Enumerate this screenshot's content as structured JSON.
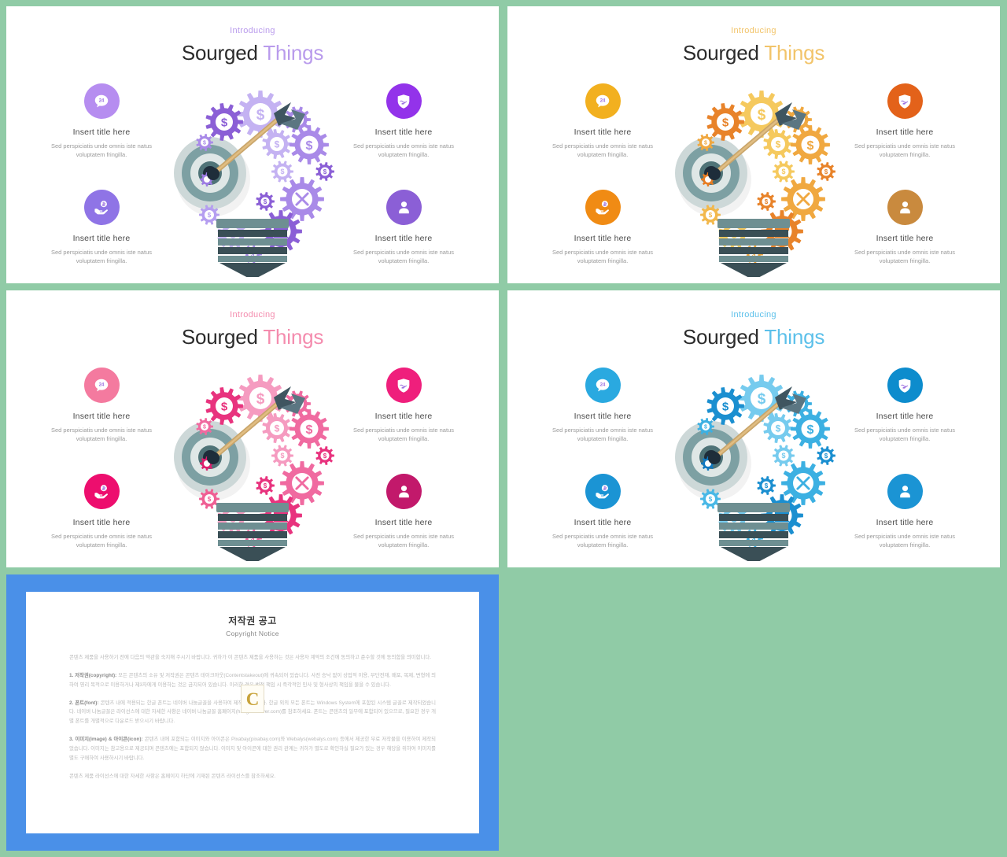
{
  "background_color": "#90cba6",
  "slides": [
    {
      "id": "purple",
      "accent": "#9b6fe0",
      "accent_light": "#b99bec",
      "intro": "Introducing",
      "title_word1": "Sourged",
      "title_word2": "Things",
      "gear_colors": [
        "#8b5fd6",
        "#a98ae8",
        "#c4b2f2",
        "#9d7ce4",
        "#b59ef0",
        "#7f4fd0",
        "#cbbdf5"
      ],
      "items": [
        {
          "icon": "chat-bubble-icon",
          "title": "Insert title here",
          "desc": "Sed perspiciatis unde omnis iste natus voluptatem fringilla."
        },
        {
          "icon": "hand-money-icon",
          "title": "Insert title here",
          "desc": "Sed perspiciatis unde omnis iste natus voluptatem fringilla."
        },
        {
          "icon": "shield-hand-icon",
          "title": "Insert title here",
          "desc": "Sed perspiciatis unde omnis iste natus voluptatem fringilla."
        },
        {
          "icon": "user-icon",
          "title": "Insert title here",
          "desc": "Sed perspiciatis unde omnis iste natus voluptatem fringilla."
        }
      ],
      "item_icon_colors": [
        "#b68df0",
        "#8f74e6",
        "#9333ea",
        "#8b5fd6"
      ]
    },
    {
      "id": "orange",
      "accent": "#e8a33a",
      "accent_light": "#f2c46a",
      "intro": "Introducing",
      "title_word1": "Sourged",
      "title_word2": "Things",
      "gear_colors": [
        "#e8832a",
        "#f0a840",
        "#f5c95e",
        "#e87d22",
        "#f2b84c",
        "#d96a18",
        "#f7d77e"
      ],
      "items": [
        {
          "icon": "chat-bubble-icon",
          "title": "Insert title here",
          "desc": "Sed perspiciatis unde omnis iste natus voluptatem fringilla."
        },
        {
          "icon": "hand-money-icon",
          "title": "Insert title here",
          "desc": "Sed perspiciatis unde omnis iste natus voluptatem fringilla."
        },
        {
          "icon": "shield-hand-icon",
          "title": "Insert title here",
          "desc": "Sed perspiciatis unde omnis iste natus voluptatem fringilla."
        },
        {
          "icon": "user-icon",
          "title": "Insert title here",
          "desc": "Sed perspiciatis unde omnis iste natus voluptatem fringilla."
        }
      ],
      "item_icon_colors": [
        "#f2b01f",
        "#f08b14",
        "#e3621a",
        "#c98a3e"
      ]
    },
    {
      "id": "pink",
      "accent": "#ef5f8c",
      "accent_light": "#f48cae",
      "intro": "Introducing",
      "title_word1": "Sourged",
      "title_word2": "Things",
      "gear_colors": [
        "#e8337e",
        "#f06aa0",
        "#f59bc0",
        "#de1f6e",
        "#ef5f94",
        "#c71563",
        "#f7b6d2"
      ],
      "items": [
        {
          "icon": "chat-bubble-icon",
          "title": "Insert title here",
          "desc": "Sed perspiciatis unde omnis iste natus voluptatem fringilla."
        },
        {
          "icon": "hand-money-icon",
          "title": "Insert title here",
          "desc": "Sed perspiciatis unde omnis iste natus voluptatem fringilla."
        },
        {
          "icon": "shield-hand-icon",
          "title": "Insert title here",
          "desc": "Sed perspiciatis unde omnis iste natus voluptatem fringilla."
        },
        {
          "icon": "user-icon",
          "title": "Insert title here",
          "desc": "Sed perspiciatis unde omnis iste natus voluptatem fringilla."
        }
      ],
      "item_icon_colors": [
        "#f47a9f",
        "#ed0e6e",
        "#ef1f7c",
        "#c2196b"
      ]
    },
    {
      "id": "blue",
      "accent": "#29a3dc",
      "accent_light": "#5cc0ea",
      "intro": "Introducing",
      "title_word1": "Sourged",
      "title_word2": "Things",
      "gear_colors": [
        "#1b8fd0",
        "#3cb0e2",
        "#76cbee",
        "#1078c0",
        "#49b8e6",
        "#0a68ae",
        "#9adcf3"
      ],
      "items": [
        {
          "icon": "chat-bubble-icon",
          "title": "Insert title here",
          "desc": "Sed perspiciatis unde omnis iste natus voluptatem fringilla."
        },
        {
          "icon": "hand-money-icon",
          "title": "Insert title here",
          "desc": "Sed perspiciatis unde omnis iste natus voluptatem fringilla."
        },
        {
          "icon": "shield-hand-icon",
          "title": "Insert title here",
          "desc": "Sed perspiciatis unde omnis iste natus voluptatem fringilla."
        },
        {
          "icon": "user-icon",
          "title": "Insert title here",
          "desc": "Sed perspiciatis unde omnis iste natus voluptatem fringilla."
        }
      ],
      "item_icon_colors": [
        "#2aa9e0",
        "#1b94d4",
        "#0d8ccd",
        "#1b94d4"
      ]
    }
  ],
  "bulb": {
    "chat_badge": "24",
    "gear_symbol_dollar": "$",
    "base_color_light": "#6e8f92",
    "base_color_dark": "#3a4f56",
    "target_rings": [
      "#cdd8d8",
      "#7da0a3",
      "#dfe7e6",
      "#4f7377",
      "#1e2d3a"
    ]
  },
  "copyright": {
    "frame_color": "#4a90e8",
    "title_ko": "저작권 공고",
    "title_en": "Copyright Notice",
    "watermark_letter": "C",
    "paragraphs": [
      {
        "lead": "",
        "text": "콘텐츠 제품을 사용하기 전에 다음의 약관을 숙지해 주시기 바랍니다. 귀하가 이 콘텐츠 제품을 사용하는 것은 사용자 계약의 조건에 동의하고 준수할 것에 동의함을 의미합니다."
      },
      {
        "lead": "1. 저작권(copyright):",
        "text": " 모든 콘텐츠의 소유 및 저작권은 콘텐츠 테이크아웃(Contentstakeout)에 귀속되어 있습니다. 사전 승낙 없이 상업적 이용, 무단전재, 배포, 복제, 변형에 의하여 영리 목적으로 이용하거나 제3자에게 이용하는 것은 금지되어 있습니다. 이러한 경우 법적 책임 시 즉각적인 민사 및 형사상의 책임을 물을 수 있습니다."
      },
      {
        "lead": "2. 폰트(font):",
        "text": " 콘텐츠 내에 적용되는 한글 폰트는 네이버 나눔글꼴을 사용하여 제작되었습니다. 한글 외의 모든 폰트는 Windows System에 포함된 시스템 글꼴로 제작되었습니다. 네이버 나눔글꼴은 라이선스에 대한 자세한 사항은 네이버 나눔글꼴 홈페이지(hangeul.naver.com)를 참조하세요. 폰트는 콘텐츠의 일부에 포함되어 있으므로, 필요한 경우 개별 폰트를 개별적으로 다운로드 받으시기 바랍니다."
      },
      {
        "lead": "3. 이미지(image) & 아이콘(icon):",
        "text": " 콘텐츠 내에 포함되는 이미지와 아이콘은 Pixabay(pixabay.com)와 Webalys(webalys.com) 등에서 제공한 무료 저작물을 이용하여 제작되었습니다. 이미지는 참고용으로 제공되며 콘텐츠에는 포함되지 않습니다. 이미지 및 아이콘에 대한 권리 관계는 귀하가 별도로 확인하실 필요가 있는 경우 해당을 위하여 이미지를 별도 구매하여 사용하시기 바랍니다."
      },
      {
        "lead": "",
        "text": "콘텐츠 제품 라이선스에 대한 자세한 사항은 홈페이지 하단에 기재된 콘텐츠 라이선스를 참조하세요."
      }
    ]
  }
}
